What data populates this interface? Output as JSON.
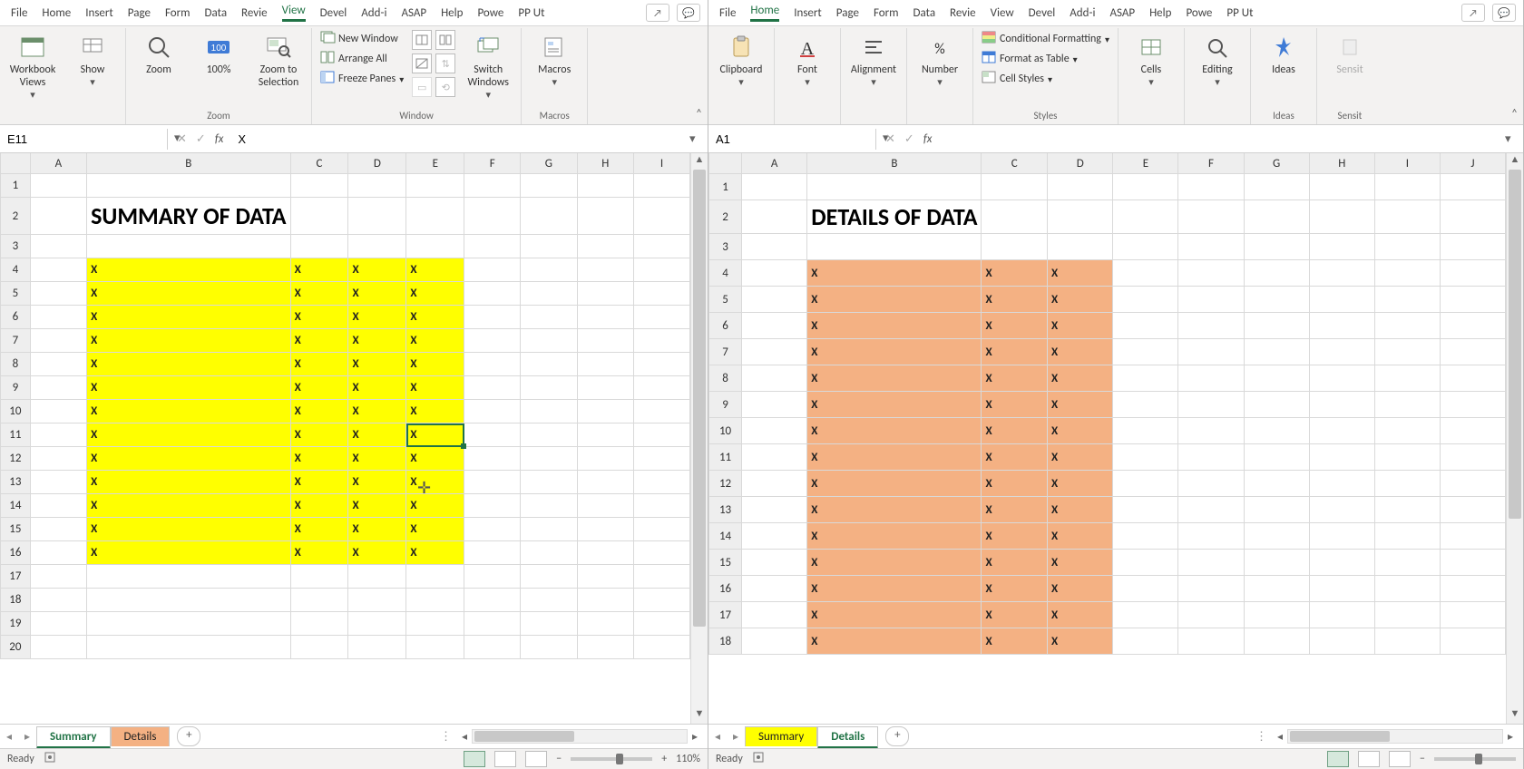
{
  "ribbonTabs": [
    "File",
    "Home",
    "Insert",
    "Page",
    "Form",
    "Data",
    "Revie",
    "View",
    "Devel",
    "Add-i",
    "ASAP",
    "Help",
    "Powe",
    "PP Ut"
  ],
  "left": {
    "activeTab": "View",
    "ribbon": {
      "zoom": {
        "label": "Zoom",
        "workbookViews": "Workbook\nViews",
        "show": "Show",
        "zoom": "Zoom",
        "hundred": "100%",
        "zoomSel": "Zoom to\nSelection"
      },
      "window": {
        "label": "Window",
        "newWindow": "New Window",
        "arrangeAll": "Arrange All",
        "freezePanes": "Freeze Panes",
        "switch": "Switch\nWindows"
      },
      "macros": {
        "label": "Macros",
        "macros": "Macros"
      }
    },
    "nameBox": "E11",
    "formula": "X",
    "columns": [
      "A",
      "B",
      "C",
      "D",
      "E",
      "F",
      "G",
      "H",
      "I"
    ],
    "title": "SUMMARY OF DATA",
    "dataCols": 4,
    "dataRows": 13,
    "dataValue": "X",
    "selectedCell": "E11",
    "sheetTabs": [
      {
        "name": "Summary",
        "active": true
      },
      {
        "name": "Details",
        "color": "orange"
      }
    ],
    "status": "Ready",
    "zoomPct": "110%"
  },
  "right": {
    "activeTab": "Home",
    "ribbon": {
      "groups": [
        "Clipboard",
        "Font",
        "Alignment",
        "Number"
      ],
      "stylesLabel": "Styles",
      "condFmt": "Conditional Formatting",
      "fmtTable": "Format as Table",
      "cellStyles": "Cell Styles",
      "cells": "Cells",
      "editing": "Editing",
      "ideas": "Ideas",
      "ideasLabel": "Ideas",
      "sensitivity": "Sensit",
      "sensitivityLabel": "Sensit"
    },
    "nameBox": "A1",
    "formula": "",
    "columns": [
      "A",
      "B",
      "C",
      "D",
      "E",
      "F",
      "G",
      "H",
      "I",
      "J"
    ],
    "title": "DETAILS OF DATA",
    "dataCols": 3,
    "dataRows": 15,
    "dataValue": "X",
    "sheetTabs": [
      {
        "name": "Summary",
        "color": "yellow"
      },
      {
        "name": "Details",
        "active": true
      }
    ],
    "status": "Ready"
  }
}
